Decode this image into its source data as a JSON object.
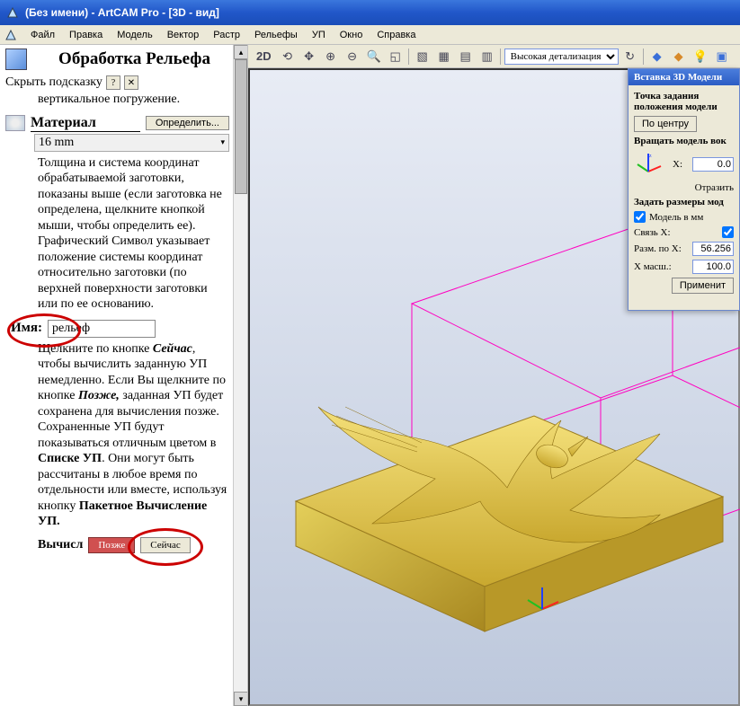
{
  "title": "(Без имени) - ArtCAM Pro - [3D - вид]",
  "menu": [
    "Файл",
    "Правка",
    "Модель",
    "Вектор",
    "Растр",
    "Рельефы",
    "УП",
    "Окно",
    "Справка"
  ],
  "sidebar": {
    "header": "Обработка Рельефа",
    "hide_hint": "Скрыть подсказку",
    "vert_plunge": "вертикальное погружение.",
    "material_label": "Материал",
    "define_btn": "Определить...",
    "material_value": "16 mm",
    "material_desc": "Толщина и система координат обрабатываемой заготовки, показаны выше (если заготовка не определена, щелкните кнопкой мыши, чтобы определить ее). Графический Символ указывает положение системы координат относительно заготовки (по верхней поверхности заготовки или по ее основанию.",
    "name_label": "Имя:",
    "name_value": "рельеф",
    "calc_text_1": "Щелкните по кнопке ",
    "calc_text_now": "Сейчас",
    "calc_text_2": ", чтобы вычислить заданную УП немедленно. Если Вы щелкните по кнопке ",
    "calc_text_later": "Позже,",
    "calc_text_3": " заданная УП будет сохранена для вычисления позже. Сохраненные УП будут показываться отличным цветом в ",
    "calc_text_list": "Списке УП",
    "calc_text_4": ". Они могут быть рассчитаны в любое время по отдельности или вместе, используя кнопку ",
    "calc_text_batch": "Пакетное Вычисление УП.",
    "calc_label": "Вычисл",
    "btn_later": "Позже",
    "btn_now": "Сейчас"
  },
  "toolbar": {
    "mode_2d": "2D",
    "lod": "Высокая детализация"
  },
  "panel": {
    "title": "Вставка 3D Модели",
    "origin_label": "Точка задания положения модели",
    "center_btn": "По центру",
    "rotate_label": "Вращать модель вок",
    "x_label": "X:",
    "x_value": "0.0",
    "mirror_label": "Отразить",
    "size_label": "Задать размеры мод",
    "model_mm_label": "Модель в мм",
    "link_label": "Связь X:",
    "size_x_label": "Разм. по X:",
    "size_x_value": "56.256",
    "scale_x_label": "X масш.:",
    "scale_x_value": "100.0",
    "apply_btn": "Применит"
  }
}
